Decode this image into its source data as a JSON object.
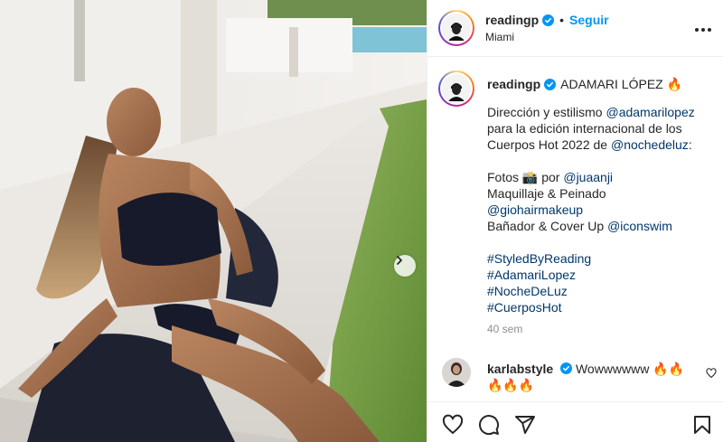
{
  "post": {
    "username": "readingp",
    "follow_label": "Seguir",
    "separator": "•",
    "location": "Miami"
  },
  "caption": {
    "username": "readingp",
    "title": "ADAMARI LÓPEZ 🔥",
    "line1_text": "Dirección y estilismo ",
    "line1_mention": "@adamarilopez",
    "line2_text": "para la edición internacional de los",
    "line3_text": "Cuerpos Hot 2022 de ",
    "line3_mention": "@nochedeluz",
    "line3_suffix": ":",
    "photos_text": "Fotos 📸 por ",
    "photos_mention": "@juaanji",
    "makeup_text": "Maquillaje & Peinado",
    "makeup_mention": "@giohairmakeup",
    "swim_text": "Bañador & Cover Up ",
    "swim_mention": "@iconswim",
    "hashtags": [
      "#StyledByReading",
      "#AdamariLopez",
      "#NocheDeLuz",
      "#CuerposHot"
    ],
    "time": "40 sem"
  },
  "comment": {
    "username": "karlabstyle",
    "text": "Wowwwwww 🔥🔥🔥🔥🔥"
  },
  "icons": {
    "verified": "verified-badge-icon",
    "more": "more-options-icon",
    "next": "chevron-right-icon",
    "like": "heart-icon",
    "comment": "comment-icon",
    "share": "share-icon",
    "save": "bookmark-icon"
  },
  "colors": {
    "accent": "#0095f6",
    "link": "#00376b",
    "muted": "#8e8e8e",
    "text": "#262626"
  }
}
